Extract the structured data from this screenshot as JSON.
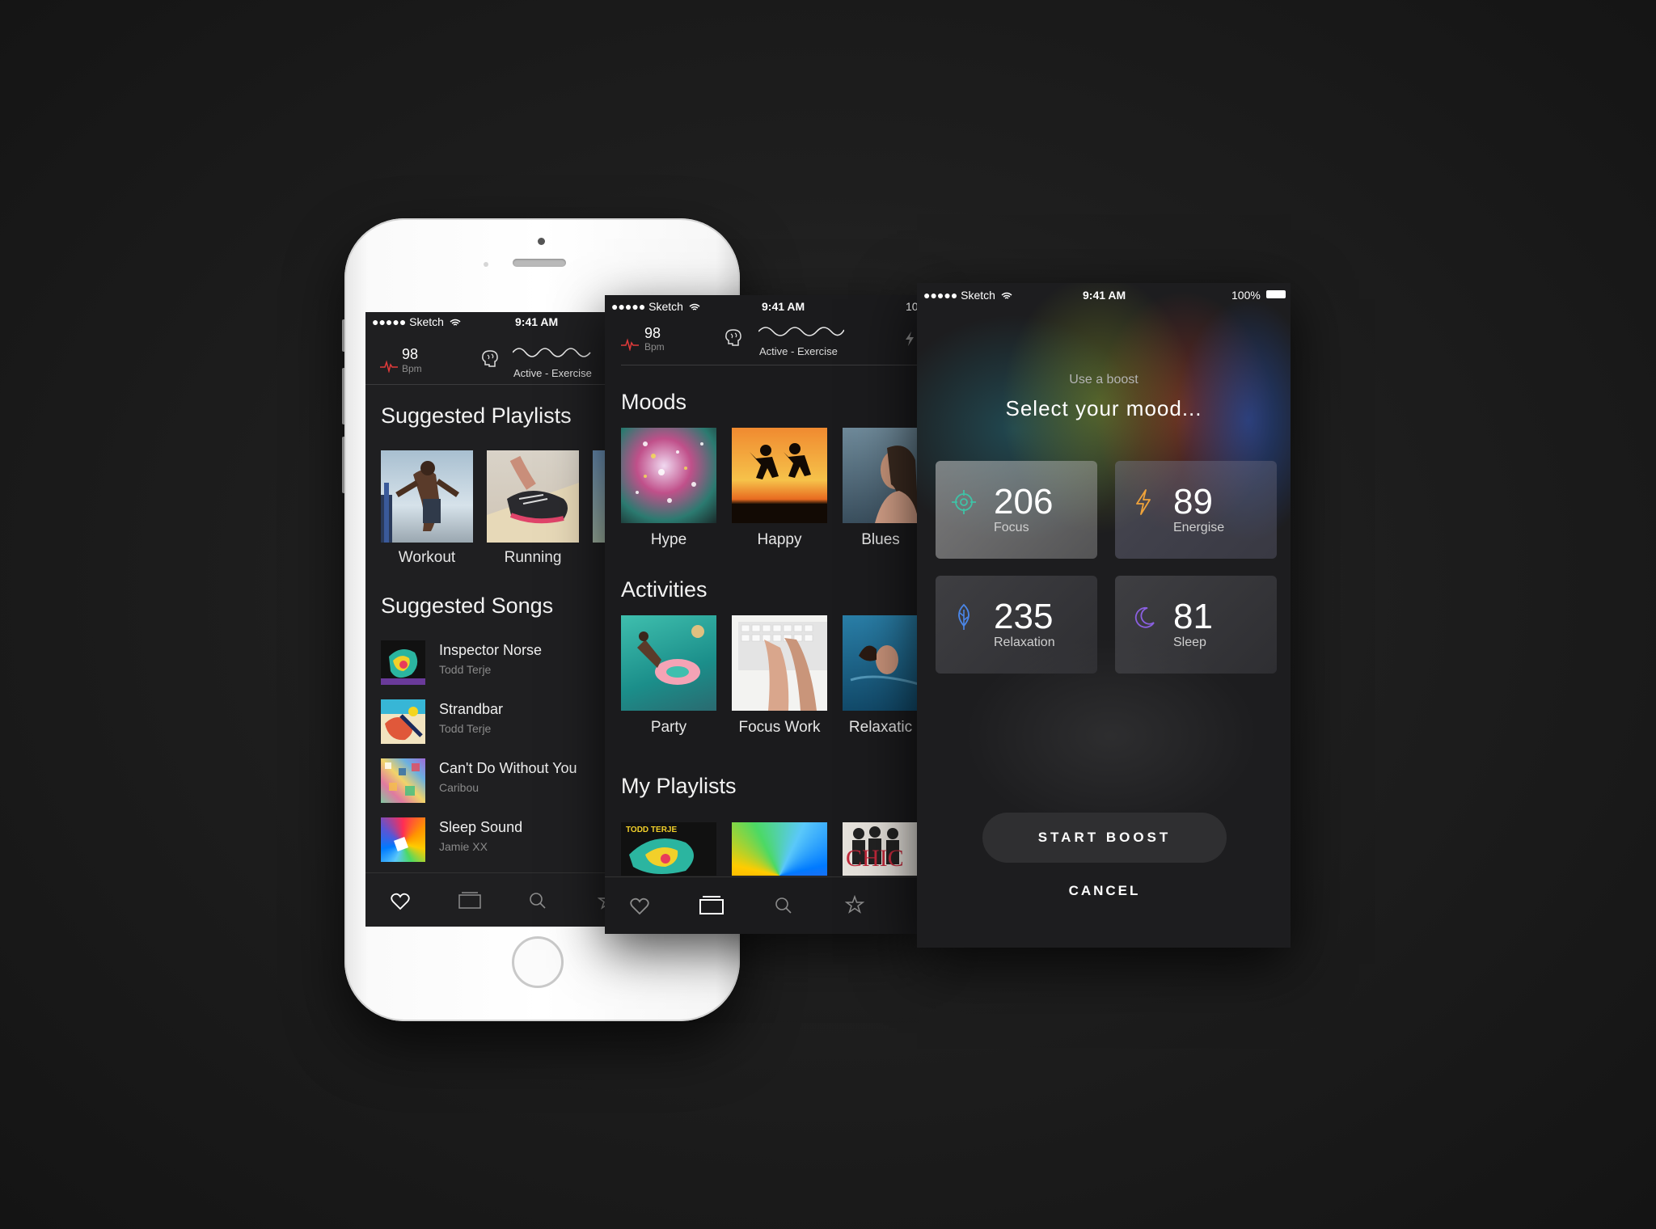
{
  "status_bar": {
    "carrier": "●●●●● Sketch",
    "time": "9:41 AM",
    "battery": "100%",
    "battery_partial": "10"
  },
  "metrics": {
    "bpm_value": "98",
    "bpm_unit": "Bpm",
    "mode": "Active - Exercise"
  },
  "screen_home": {
    "suggested_playlists_title": "Suggested Playlists",
    "playlists": [
      {
        "label": "Workout"
      },
      {
        "label": "Running"
      }
    ],
    "suggested_songs_title": "Suggested Songs",
    "songs": [
      {
        "title": "Inspector Norse",
        "artist": "Todd Terje"
      },
      {
        "title": "Strandbar",
        "artist": "Todd Terje"
      },
      {
        "title": "Can't Do Without You",
        "artist": "Caribou"
      },
      {
        "title": "Sleep Sound",
        "artist": "Jamie XX"
      }
    ]
  },
  "screen_browse": {
    "moods_title": "Moods",
    "moods": [
      {
        "label": "Hype"
      },
      {
        "label": "Happy"
      },
      {
        "label": "Blues"
      }
    ],
    "activities_title": "Activities",
    "activities": [
      {
        "label": "Party"
      },
      {
        "label": "Focus Work"
      },
      {
        "label": "Relaxatic"
      }
    ],
    "my_playlists_title": "My Playlists",
    "my_playlists": [
      {
        "art_text": "TODD TERJE"
      },
      {
        "art_text": ""
      },
      {
        "art_text": "CHIC"
      }
    ]
  },
  "screen_boost": {
    "subtitle": "Use a boost",
    "title": "Select your mood...",
    "moods": [
      {
        "value": "206",
        "label": "Focus",
        "icon": "target-icon",
        "color": "#3fc2a6"
      },
      {
        "value": "89",
        "label": "Energise",
        "icon": "bolt-icon",
        "color": "#f0a33a"
      },
      {
        "value": "235",
        "label": "Relaxation",
        "icon": "leaf-icon",
        "color": "#4a86e8"
      },
      {
        "value": "81",
        "label": "Sleep",
        "icon": "moon-icon",
        "color": "#8a5fe0"
      }
    ],
    "start_label": "START BOOST",
    "cancel_label": "CANCEL"
  },
  "tabbar": {
    "items": [
      "heart-icon",
      "library-icon",
      "search-icon",
      "star-icon"
    ]
  }
}
